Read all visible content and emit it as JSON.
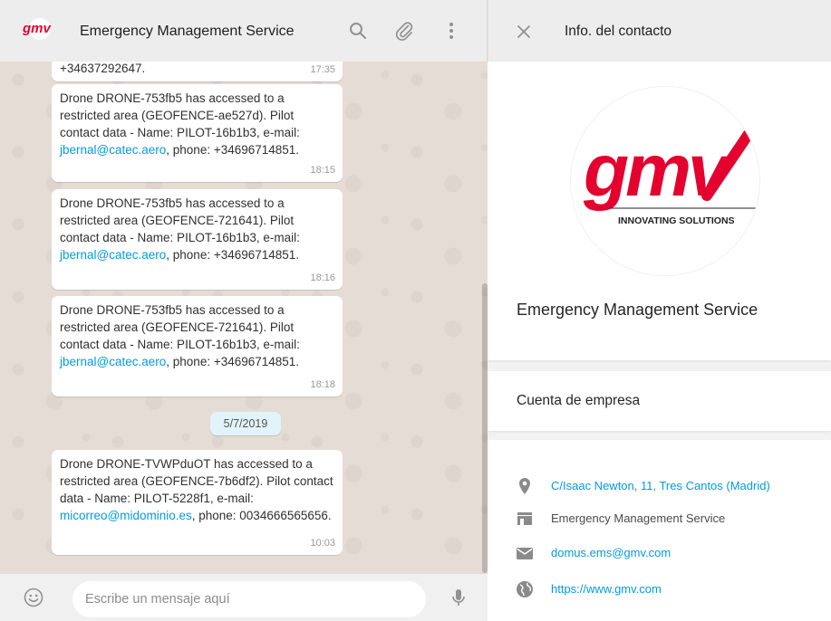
{
  "chat": {
    "title": "Emergency Management Service",
    "logo_text": "gmv",
    "messages": [
      {
        "text": "+34637292647.",
        "time": "17:35"
      },
      {
        "text": "Drone DRONE-753fb5 has accessed to a restricted area (GEOFENCE-ae527d). Pilot contact data - Name: PILOT-16b1b3, e-mail:",
        "email": "jbernal@catec.aero",
        "suffix": ", phone: +34696714851.",
        "time": "18:15"
      },
      {
        "text": "Drone DRONE-753fb5 has accessed to a restricted area (GEOFENCE-721641). Pilot contact data - Name: PILOT-16b1b3, e-mail:",
        "email": "jbernal@catec.aero",
        "suffix": ", phone: +34696714851.",
        "time": "18:16"
      },
      {
        "text": "Drone DRONE-753fb5 has accessed to a restricted area (GEOFENCE-721641). Pilot contact data - Name: PILOT-16b1b3, e-mail:",
        "email": "jbernal@catec.aero",
        "suffix": ", phone: +34696714851.",
        "time": "18:18"
      },
      {
        "text": "Drone DRONE-TVWPduOT has accessed to a restricted area (GEOFENCE-7b6df2). Pilot contact data - Name: PILOT-5228f1, e-mail:",
        "email": "micorreo@midominio.es",
        "suffix": ", phone: 0034666565656.",
        "time": "10:03"
      }
    ],
    "date_separator": "5/7/2019",
    "composer_placeholder": "Escribe un mensaje aquí"
  },
  "info": {
    "title": "Info. del contacto",
    "logo_text": "gmv",
    "logo_tagline": "INNOVATING SOLUTIONS",
    "profile_name": "Emergency Management Service",
    "business_label": "Cuenta de empresa",
    "details": {
      "address": "C/Isaac Newton, 11, Tres Cantos (Madrid)",
      "category": "Emergency Management Service",
      "email": "domus.ems@gmv.com",
      "website": "https://www.gmv.com"
    }
  },
  "colors": {
    "brand_red": "#e4032e",
    "link_blue": "#039be5",
    "chat_bg": "#e5ddd5",
    "header_bg": "#ededed"
  }
}
